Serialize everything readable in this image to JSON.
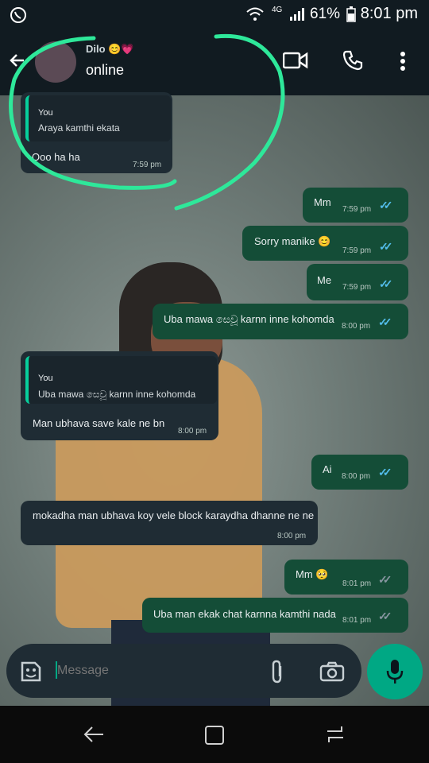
{
  "status_bar": {
    "network": "4G",
    "battery": "61%",
    "time": "8:01 pm"
  },
  "header": {
    "contact_name": "Dilo",
    "contact_emojis": "😊💗",
    "contact_status": "online"
  },
  "messages": [
    {
      "direction": "in",
      "quoted_name": "You",
      "quoted_text": "Araya kamthi ekata",
      "text": "Ooo ha ha",
      "time": "7:59 pm"
    },
    {
      "direction": "out",
      "text": "Mm",
      "time": "7:59 pm",
      "status": "read"
    },
    {
      "direction": "out",
      "text": "Sorry manike 😊",
      "time": "7:59 pm",
      "status": "read"
    },
    {
      "direction": "out",
      "text": "Me",
      "time": "7:59 pm",
      "status": "read"
    },
    {
      "direction": "out",
      "text": "Uba mawa සෙවූ karnn inne kohomda",
      "time": "8:00 pm",
      "status": "read"
    },
    {
      "direction": "in",
      "quoted_name": "You",
      "quoted_text": "Uba mawa සෙවූ karnn inne kohomda",
      "text": "Man ubhava save kale ne bn",
      "time": "8:00 pm"
    },
    {
      "direction": "out",
      "text": "Ai",
      "time": "8:00 pm",
      "status": "read"
    },
    {
      "direction": "in",
      "text": "mokadha man ubhava koy vele block karaydha dhanne ne ne",
      "time": "8:00 pm"
    },
    {
      "direction": "out",
      "text": "Mm 🥺",
      "time": "8:01 pm",
      "status": "delivered"
    },
    {
      "direction": "out",
      "text": "Uba man ekak chat karnna kamthi nada",
      "time": "8:01 pm",
      "status": "delivered"
    }
  ],
  "input": {
    "placeholder": "Message"
  },
  "colors": {
    "accent": "#00a884",
    "read_ticks": "#53bdeb",
    "delivered_ticks": "#8696a0",
    "annotation": "#2ee89a"
  },
  "icons": [
    "whatsapp-icon",
    "wifi-icon",
    "signal-icon",
    "battery-icon",
    "back-arrow-icon",
    "video-call-icon",
    "phone-icon",
    "more-vert-icon",
    "emoji-sticker-icon",
    "attach-icon",
    "camera-icon",
    "mic-icon",
    "nav-back-icon",
    "nav-home-icon",
    "nav-recents-icon"
  ]
}
